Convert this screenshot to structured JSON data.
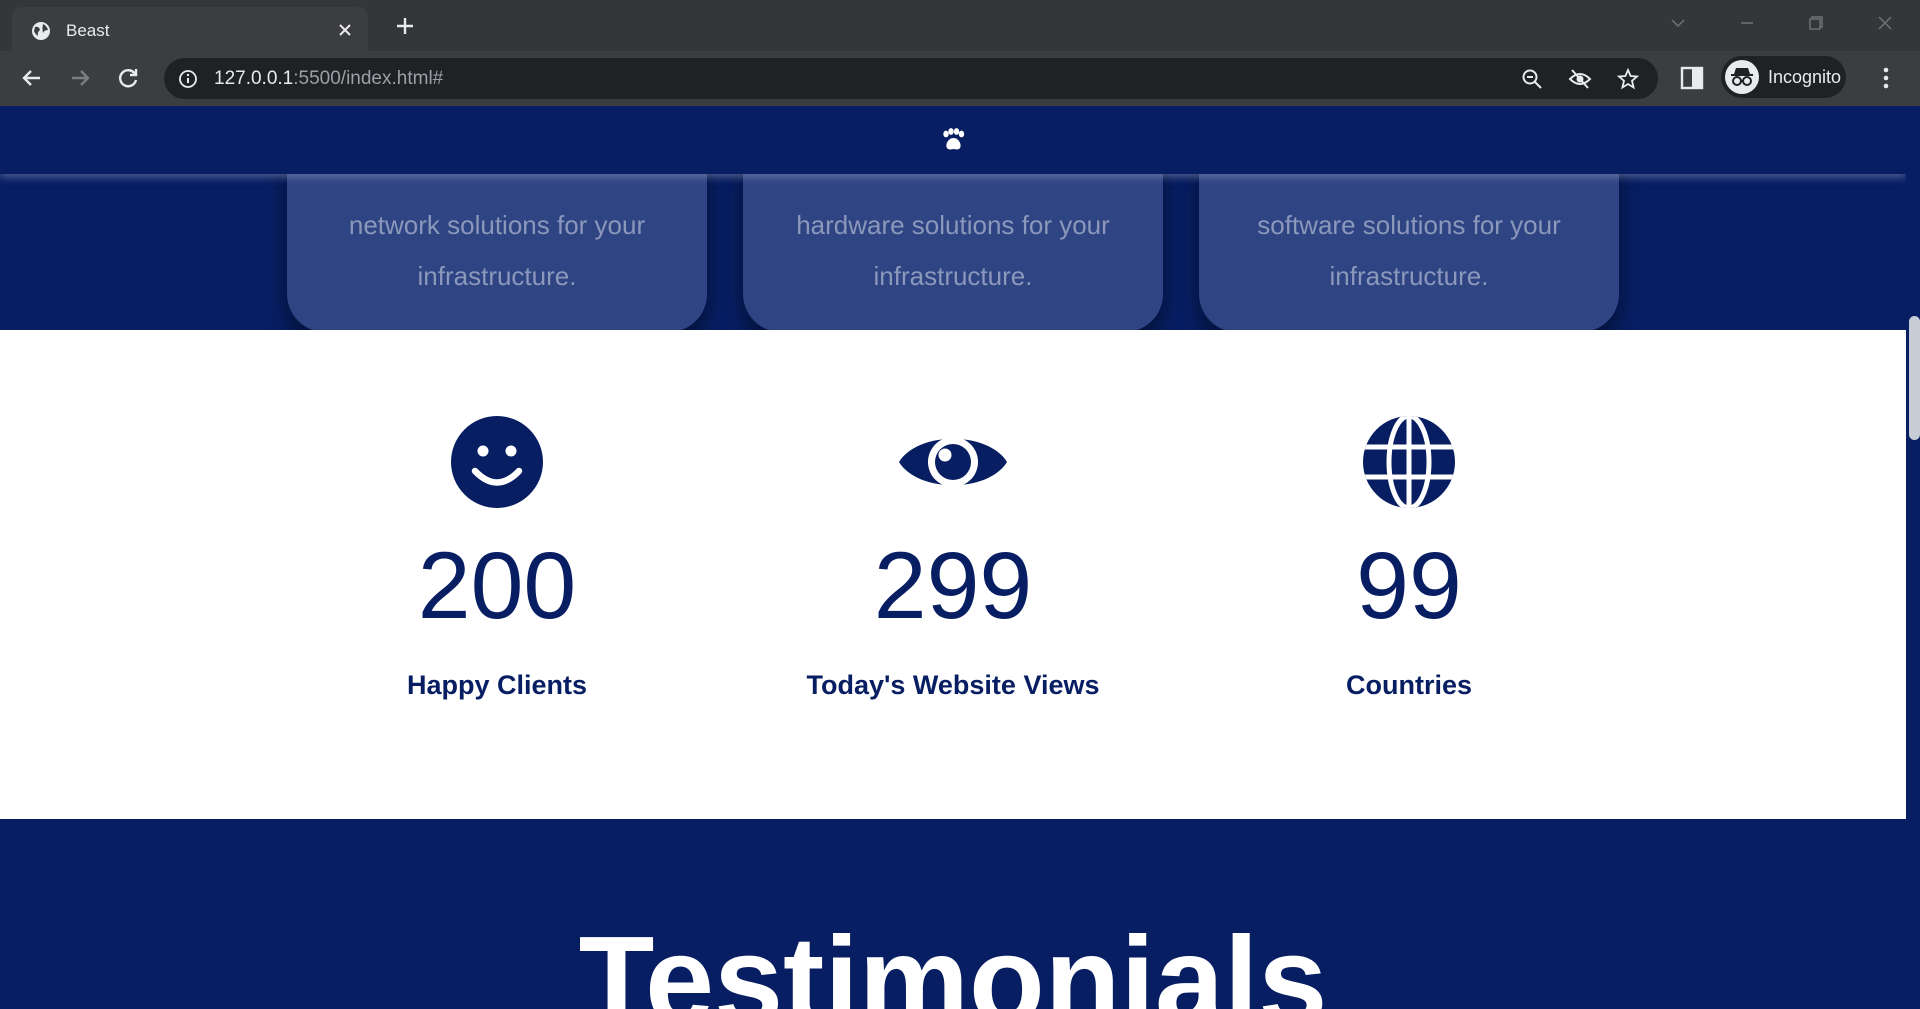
{
  "browser": {
    "tab_title": "Beast",
    "url_host": "127.0.0.1",
    "url_rest": ":5500/index.html#",
    "profile_label": "Incognito",
    "chrome_bg": "#35363a",
    "toolbar_bg": "#3c3d40"
  },
  "page": {
    "accent_color": "#071e63",
    "nav_logo_icon": "paw-icon",
    "service_cards": [
      {
        "text_line1": "network solutions for your",
        "text_line2": "infrastructure."
      },
      {
        "text_line1": "hardware solutions for your",
        "text_line2": "infrastructure."
      },
      {
        "text_line1": "software solutions for your",
        "text_line2": "infrastructure."
      }
    ],
    "stats": [
      {
        "icon": "smiley-icon",
        "number": "200",
        "label": "Happy Clients"
      },
      {
        "icon": "eye-icon",
        "number": "299",
        "label": "Today's Website Views"
      },
      {
        "icon": "globe-icon",
        "number": "99",
        "label": "Countries"
      }
    ],
    "testimonials_title": "Testimonials"
  }
}
